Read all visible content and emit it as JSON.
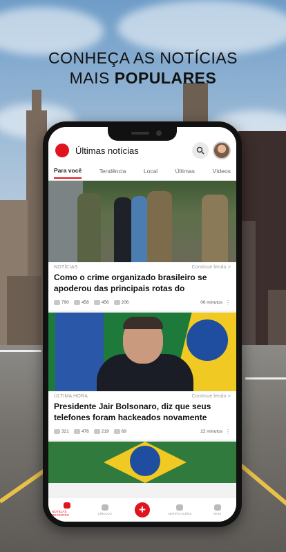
{
  "promo": {
    "line1": "CONHEÇA AS NOTÍCIAS",
    "line2_normal": "MAIS",
    "line2_bold": "POPULARES"
  },
  "app": {
    "title": "Últimas notícias",
    "brand_color": "#e0141e"
  },
  "tabs": [
    {
      "label": "Para você",
      "active": true
    },
    {
      "label": "Tendência"
    },
    {
      "label": "Local"
    },
    {
      "label": "Últimas"
    },
    {
      "label": "Vídeos"
    }
  ],
  "articles": [
    {
      "category": "NOTÍCIAS",
      "continue_label": "Continue lendo >",
      "title": "Como o crime organizado brasileiro se apoderou das principais rotas do",
      "likes": "790",
      "dislikes": "458",
      "comments": "456",
      "shares": "206",
      "read_time": "06 minutos"
    },
    {
      "category": "ÚLTIMA HORA",
      "continue_label": "Continue lendo >",
      "title": "Presidente Jair Bolsonaro, diz que seus telefones foram hackeados novamente",
      "likes": "321",
      "dislikes": "476",
      "comments": "219",
      "shares": "69",
      "read_time": "22 minutos"
    }
  ],
  "bottom_nav": [
    {
      "label": "NOTÍCIAS RECENTES",
      "icon": "news-icon",
      "active": true
    },
    {
      "label": "CÍRCULO",
      "icon": "people-icon"
    },
    {
      "label": "",
      "icon": "plus-icon",
      "fab": true
    },
    {
      "label": "NOTIFICAÇÕES",
      "icon": "bell-icon"
    },
    {
      "label": "MAIS",
      "icon": "more-icon"
    }
  ]
}
